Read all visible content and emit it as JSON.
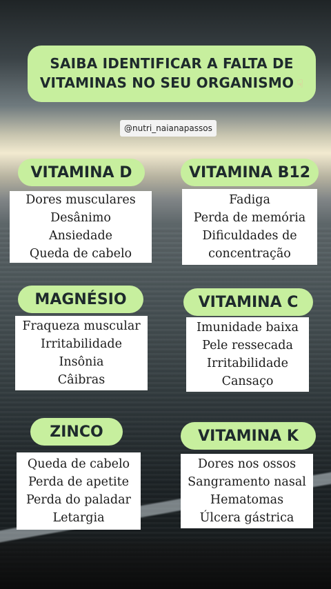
{
  "title": {
    "line1": "SAIBA IDENTIFICAR A FALTA DE",
    "line2": "VITAMINAS NO SEU ORGANISMO",
    "icon": "pointing-hand-icon"
  },
  "handle": "@nutri_naianapassos",
  "cards": [
    {
      "name": "VITAMINA D",
      "symptoms": [
        "Dores musculares",
        "Desânimo",
        "Ansiedade",
        "Queda de cabelo"
      ]
    },
    {
      "name": "VITAMINA B12",
      "symptoms": [
        "Fadiga",
        "Perda de memória",
        "Dificuldades de",
        "concentração"
      ]
    },
    {
      "name": "MAGNÉSIO",
      "symptoms": [
        "Fraqueza muscular",
        "Irritabilidade",
        "Insônia",
        "Câibras"
      ]
    },
    {
      "name": "VITAMINA C",
      "symptoms": [
        "Imunidade baixa",
        "Pele ressecada",
        "Irritabilidade",
        "Cansaço"
      ]
    },
    {
      "name": "ZINCO",
      "symptoms": [
        "Queda de cabelo",
        "Perda de apetite",
        "Perda do paladar",
        "Letargia"
      ]
    },
    {
      "name": "VITAMINA K",
      "symptoms": [
        "Dores nos ossos",
        "Sangramento nasal",
        "Hematomas",
        "Úlcera gástrica"
      ]
    }
  ],
  "colors": {
    "accent": "#c7ef9e",
    "text": "#1e2a2c",
    "card": "#ffffff"
  }
}
